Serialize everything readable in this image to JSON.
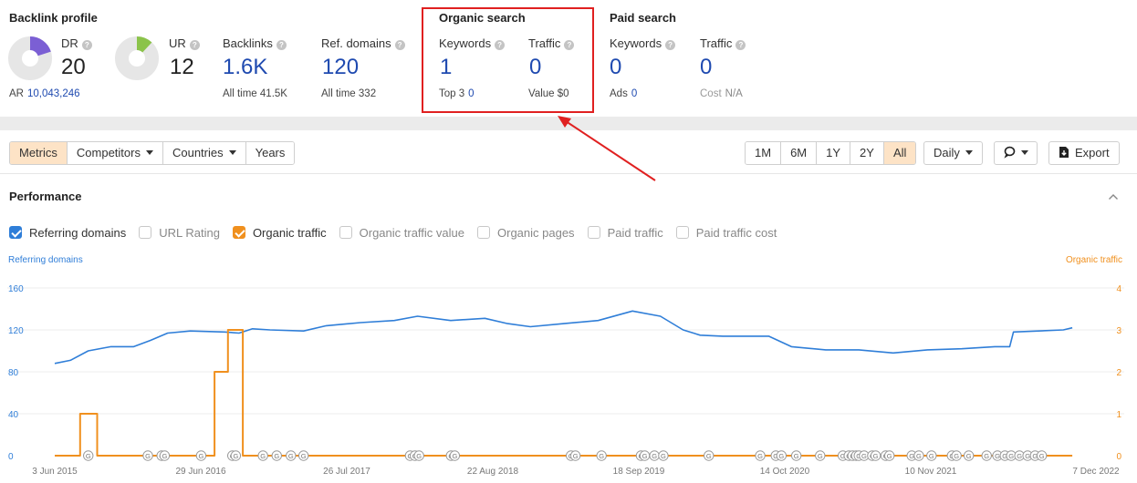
{
  "backlink": {
    "title": "Backlink profile",
    "dr_label": "DR",
    "dr_value": "20",
    "dr_fraction": 0.2,
    "ur_label": "UR",
    "ur_value": "12",
    "ur_fraction": 0.12,
    "ar_label": "AR",
    "ar_value": "10,043,246",
    "backlinks_label": "Backlinks",
    "backlinks_value": "1.6K",
    "backlinks_sub_label": "All time",
    "backlinks_sub_value": "41.5K",
    "refdomains_label": "Ref. domains",
    "refdomains_value": "120",
    "refdomains_sub_label": "All time",
    "refdomains_sub_value": "332"
  },
  "organic": {
    "title": "Organic search",
    "keywords_label": "Keywords",
    "keywords_value": "1",
    "top3_label": "Top 3",
    "top3_value": "0",
    "traffic_label": "Traffic",
    "traffic_value": "0",
    "value_label": "Value",
    "value_value": "$0"
  },
  "paid": {
    "title": "Paid search",
    "keywords_label": "Keywords",
    "keywords_value": "0",
    "ads_label": "Ads",
    "ads_value": "0",
    "traffic_label": "Traffic",
    "traffic_value": "0",
    "cost_label": "Cost",
    "cost_value": "N/A"
  },
  "toolbar": {
    "tabs": [
      "Metrics",
      "Competitors",
      "Countries",
      "Years"
    ],
    "active_tab": "Metrics",
    "ranges": [
      "1M",
      "6M",
      "1Y",
      "2Y",
      "All"
    ],
    "active_range": "All",
    "interval": "Daily",
    "export_label": "Export"
  },
  "performance": {
    "title": "Performance",
    "checkboxes": [
      {
        "label": "Referring domains",
        "checked": true,
        "color": "#2f7ed8"
      },
      {
        "label": "URL Rating",
        "checked": false
      },
      {
        "label": "Organic traffic",
        "checked": true,
        "color": "#f0901e"
      },
      {
        "label": "Organic traffic value",
        "checked": false
      },
      {
        "label": "Organic pages",
        "checked": false
      },
      {
        "label": "Paid traffic",
        "checked": false
      },
      {
        "label": "Paid traffic cost",
        "checked": false
      }
    ]
  },
  "chart_data": {
    "type": "line",
    "left_axis_label": "Referring domains",
    "right_axis_label": "Organic traffic",
    "left_ticks": [
      0,
      40,
      80,
      120,
      160
    ],
    "right_ticks": [
      0,
      1,
      2,
      3,
      4
    ],
    "ylim_left": [
      0,
      160
    ],
    "ylim_right": [
      0,
      4
    ],
    "xlim": [
      "2015-06-03",
      "2022-12-07"
    ],
    "x_ticks": [
      "3 Jun 2015",
      "29 Jun 2016",
      "26 Jul 2017",
      "22 Aug 2018",
      "18 Sep 2019",
      "14 Oct 2020",
      "10 Nov 2021",
      "7 Dec 2022"
    ],
    "grid": true,
    "series": [
      {
        "name": "Referring domains",
        "axis": "left",
        "color": "#2f7ed8",
        "points": [
          [
            "2015-06-03",
            88
          ],
          [
            "2015-07-15",
            91
          ],
          [
            "2015-09-01",
            100
          ],
          [
            "2015-11-01",
            104
          ],
          [
            "2016-01-01",
            104
          ],
          [
            "2016-02-15",
            110
          ],
          [
            "2016-04-01",
            117
          ],
          [
            "2016-06-01",
            119
          ],
          [
            "2016-09-01",
            118
          ],
          [
            "2016-10-10",
            117
          ],
          [
            "2016-11-15",
            121
          ],
          [
            "2017-01-01",
            120
          ],
          [
            "2017-04-01",
            119
          ],
          [
            "2017-06-01",
            124
          ],
          [
            "2017-09-01",
            127
          ],
          [
            "2017-12-01",
            129
          ],
          [
            "2018-02-01",
            133
          ],
          [
            "2018-05-01",
            129
          ],
          [
            "2018-08-01",
            131
          ],
          [
            "2018-10-01",
            126
          ],
          [
            "2018-12-01",
            123
          ],
          [
            "2019-03-01",
            126
          ],
          [
            "2019-06-01",
            129
          ],
          [
            "2019-09-01",
            138
          ],
          [
            "2019-11-15",
            133
          ],
          [
            "2020-01-15",
            120
          ],
          [
            "2020-03-01",
            115
          ],
          [
            "2020-05-01",
            114
          ],
          [
            "2020-09-01",
            114
          ],
          [
            "2020-11-01",
            104
          ],
          [
            "2021-02-01",
            101
          ],
          [
            "2021-05-01",
            101
          ],
          [
            "2021-08-01",
            98
          ],
          [
            "2021-11-01",
            101
          ],
          [
            "2022-02-01",
            102
          ],
          [
            "2022-05-01",
            104
          ],
          [
            "2022-06-10",
            104
          ],
          [
            "2022-06-20",
            118
          ],
          [
            "2022-11-01",
            120
          ],
          [
            "2022-11-25",
            122
          ]
        ]
      },
      {
        "name": "Organic traffic",
        "axis": "right",
        "color": "#f0901e",
        "points": [
          [
            "2015-06-03",
            0
          ],
          [
            "2015-08-10",
            0
          ],
          [
            "2015-08-10",
            1
          ],
          [
            "2015-09-25",
            1
          ],
          [
            "2015-09-25",
            0
          ],
          [
            "2016-08-05",
            0
          ],
          [
            "2016-08-05",
            2
          ],
          [
            "2016-09-10",
            2
          ],
          [
            "2016-09-10",
            3
          ],
          [
            "2016-10-20",
            3
          ],
          [
            "2016-10-20",
            0
          ],
          [
            "2022-11-25",
            0
          ]
        ]
      }
    ],
    "annotation_marker_label": "G",
    "annotation_dates": [
      "2015-09-01",
      "2016-02-08",
      "2016-03-16",
      "2016-03-24",
      "2016-06-30",
      "2016-09-22",
      "2016-10-01",
      "2016-12-13",
      "2017-01-19",
      "2017-02-26",
      "2017-04-01",
      "2018-01-12",
      "2018-01-25",
      "2018-02-05",
      "2018-05-02",
      "2018-05-12",
      "2019-03-20",
      "2019-04-01",
      "2019-06-10",
      "2019-09-24",
      "2019-10-04",
      "2019-10-30",
      "2019-11-23",
      "2020-03-24",
      "2020-08-09",
      "2020-09-20",
      "2020-10-05",
      "2020-11-14",
      "2021-01-17",
      "2021-03-19",
      "2021-04-04",
      "2021-04-14",
      "2021-04-24",
      "2021-05-01",
      "2021-05-15",
      "2021-06-06",
      "2021-06-15",
      "2021-07-12",
      "2021-07-22",
      "2021-09-20",
      "2021-10-09",
      "2021-11-12",
      "2022-01-06",
      "2022-01-18",
      "2022-02-20",
      "2022-04-09",
      "2022-05-08",
      "2022-05-28",
      "2022-06-14",
      "2022-07-06",
      "2022-07-28",
      "2022-08-17",
      "2022-09-04"
    ]
  }
}
